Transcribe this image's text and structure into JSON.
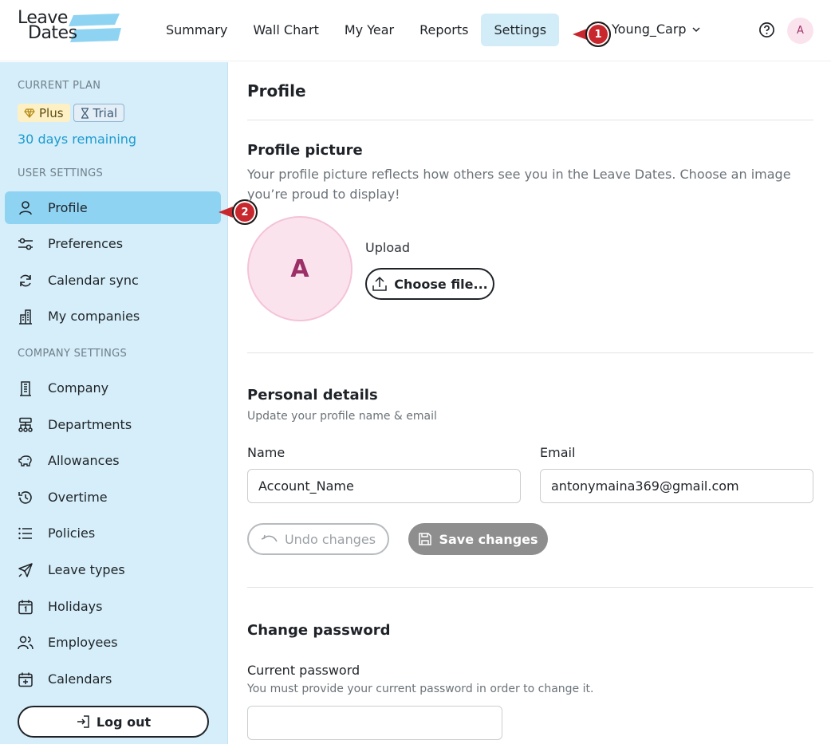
{
  "logo": {
    "line1": "Leave",
    "line2": "Dates",
    "accent_color": "#8fd3f3"
  },
  "nav": {
    "items": [
      {
        "label": "Summary"
      },
      {
        "label": "Wall Chart"
      },
      {
        "label": "My Year"
      },
      {
        "label": "Reports"
      },
      {
        "label": "Settings",
        "active": true
      }
    ],
    "account": "Young_Carp",
    "account_icon": "chevron-down-icon",
    "help_icon": "help-circle-icon",
    "avatar_initial": "A"
  },
  "annotations": {
    "marker1": "1",
    "marker2": "2",
    "color": "#c8272d"
  },
  "sidebar": {
    "current_plan_title": "CURRENT PLAN",
    "plan_badge": "Plus",
    "trial_badge": "Trial",
    "days_remaining": "30 days remaining",
    "user_settings_title": "USER SETTINGS",
    "user_items": [
      {
        "label": "Profile",
        "icon": "user-icon",
        "active": true
      },
      {
        "label": "Preferences",
        "icon": "sliders-icon"
      },
      {
        "label": "Calendar sync",
        "icon": "sync-icon"
      },
      {
        "label": "My companies",
        "icon": "buildings-icon"
      }
    ],
    "company_settings_title": "COMPANY SETTINGS",
    "company_items": [
      {
        "label": "Company",
        "icon": "building-icon"
      },
      {
        "label": "Departments",
        "icon": "org-chart-icon"
      },
      {
        "label": "Allowances",
        "icon": "piggy-bank-icon"
      },
      {
        "label": "Overtime",
        "icon": "clock-history-icon"
      },
      {
        "label": "Policies",
        "icon": "list-icon"
      },
      {
        "label": "Leave types",
        "icon": "plane-icon"
      },
      {
        "label": "Holidays",
        "icon": "calendar-one-icon"
      },
      {
        "label": "Employees",
        "icon": "users-icon"
      },
      {
        "label": "Calendars",
        "icon": "calendar-plus-icon"
      }
    ],
    "logout_label": "Log out"
  },
  "main": {
    "title": "Profile",
    "picture": {
      "title": "Profile picture",
      "description": "Your profile picture reflects how others see you in the Leave Dates. Choose an image you’re proud to display!",
      "avatar_initial": "A",
      "upload_label": "Upload",
      "choose_button": "Choose file..."
    },
    "personal": {
      "title": "Personal details",
      "description": "Update your profile name & email",
      "name_label": "Name",
      "name_value": "Account_Name",
      "email_label": "Email",
      "email_value": "antonymaina369@gmail.com",
      "undo_button": "Undo changes",
      "save_button": "Save changes"
    },
    "password": {
      "title": "Change password",
      "current_label": "Current password",
      "current_description": "You must provide your current password in order to change it.",
      "current_value": ""
    }
  }
}
